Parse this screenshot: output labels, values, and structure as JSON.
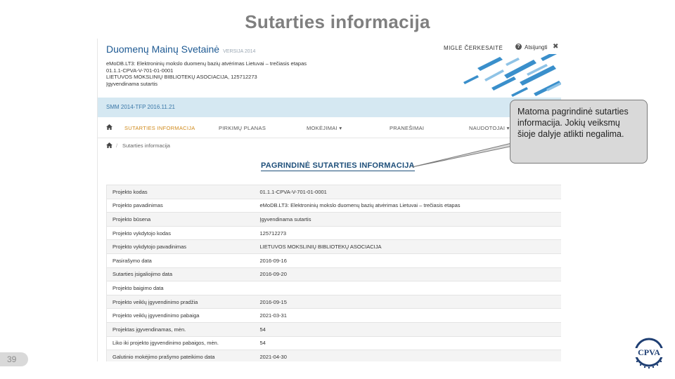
{
  "slide": {
    "title": "Sutarties informacija",
    "page_number": "39",
    "callout": "Matoma pagrindinė sutarties informacija. Jokių veiksmų šioje dalyje atlikti negalima.",
    "logo_text": "CPVA"
  },
  "site": {
    "brand": "Duomenų Mainų Svetainė",
    "brand_suffix": "VERSIJA 2014",
    "user": "MIGLĖ ČERKESAITĖ",
    "logout": "Atsijungti",
    "project_lines": [
      "eMoDB.LT3: Elektroninių mokslo duomenų bazių atvėrimas Lietuvai – trečiasis etapas",
      "01.1.1-CPVA-V-701-01-0001",
      "LIETUVOS MOKSLINIŲ BIBLIOTEKŲ ASOCIACIJA, 125712273",
      "Įgyvendinama sutartis"
    ],
    "info_bar": "SMM 2014-TFP 2016.11.21"
  },
  "nav": {
    "items": [
      "SUTARTIES INFORMACIJA",
      "PIRKIMŲ PLANAS",
      "MOKĖJIMAI ▾",
      "PRANEŠIMAI",
      "NAUDOTOJAI ▾"
    ],
    "active_index": 0
  },
  "breadcrumb": {
    "separator": "/",
    "current": "Sutarties informacija"
  },
  "section_title": "PAGRINDINĖ SUTARTIES INFORMACIJA",
  "table": {
    "rows": [
      [
        "Projekto kodas",
        "01.1.1-CPVA-V-701-01-0001"
      ],
      [
        "Projekto pavadinimas",
        "eMoDB.LT3: Elektroninių mokslo duomenų bazių atvėrimas Lietuvai – trečiasis etapas"
      ],
      [
        "Projekto būsena",
        "Įgyvendinama sutartis"
      ],
      [
        "Projekto vykdytojo kodas",
        "125712273"
      ],
      [
        "Projekto vykdytojo pavadinimas",
        "LIETUVOS MOKSLINIŲ BIBLIOTEKŲ ASOCIACIJA"
      ],
      [
        "Pasirašymo data",
        "2016-09-16"
      ],
      [
        "Sutarties įsigaliojimo data",
        "2016-09-20"
      ],
      [
        "Projekto baigimo data",
        ""
      ],
      [
        "Projekto veiklų įgyvendinimo pradžia",
        "2016-09-15"
      ],
      [
        "Projekto veiklų įgyvendinimo pabaiga",
        "2021-03-31"
      ],
      [
        "Projektas įgyvendinamas, mėn.",
        "54"
      ],
      [
        "Liko iki projekto įgyvendinimo pabaigos, mėn.",
        "54"
      ],
      [
        "Galutinio mokėjimo prašymo pateikimo data",
        "2021-04-30"
      ]
    ]
  },
  "colors": {
    "brand": "#1e5a93",
    "info_bar_bg": "#d5e8f2",
    "nav_active": "#d08a1b",
    "stripes": "#3a8fcb"
  }
}
